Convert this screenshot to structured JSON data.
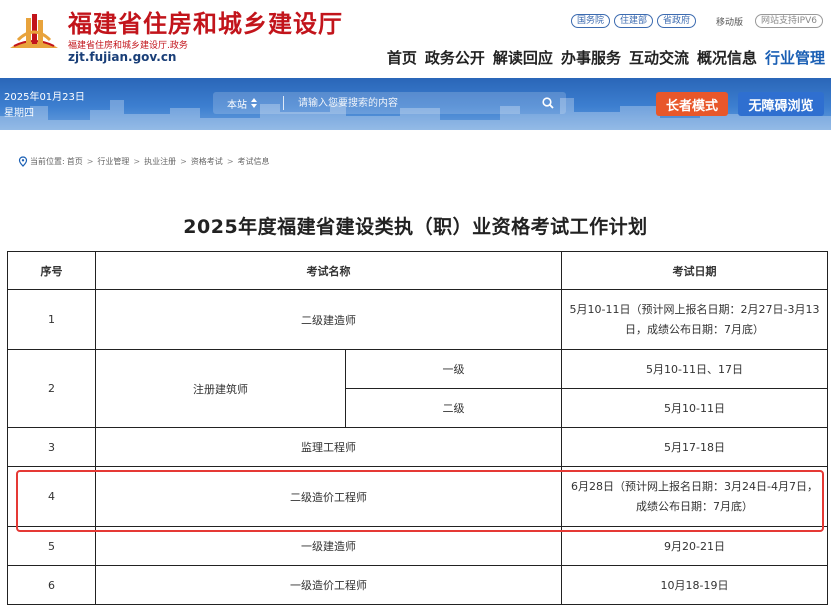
{
  "header": {
    "site_name": "福建省住房和城乡建设厅",
    "site_subtitle": "福建省住房和城乡建设厅.政务",
    "site_domain": "zjt.fujian.gov.cn",
    "top_links": [
      "国务院",
      "住建部",
      "省政府"
    ],
    "mobile_label": "移动版",
    "ipv6_label": "网站支持IPV6",
    "nav": [
      "首页",
      "政务公开",
      "解读回应",
      "办事服务",
      "互动交流",
      "概况信息",
      "行业管理"
    ],
    "active_nav": "行业管理",
    "brand_color": "#c2141b",
    "accent_color": "#1a5fb4"
  },
  "banner": {
    "date": "2025年01月23日",
    "weekday": "星期四",
    "search_scope": "本站",
    "search_placeholder": "请输入您要搜索的内容",
    "elder_mode_label": "长者模式",
    "accessible_label": "无障碍浏览",
    "elder_color": "#e8572a",
    "accessible_color": "#2f6fd0"
  },
  "breadcrumb": {
    "prefix": "当前位置:",
    "items": [
      "首页",
      "行业管理",
      "执业注册",
      "资格考试",
      "考试信息"
    ]
  },
  "page": {
    "title": "2025年度福建省建设类执（职）业资格考试工作计划"
  },
  "table": {
    "headers": [
      "序号",
      "考试名称",
      "考试日期"
    ],
    "rows": [
      {
        "no": "1",
        "name": "二级建造师",
        "date": "5月10-11日（预计网上报名日期：2月27日-3月13日，成绩公布日期：7月底）"
      },
      {
        "no": "2",
        "name": "注册建筑师",
        "level": "一级",
        "date": "5月10-11日、17日"
      },
      {
        "level": "二级",
        "date": "5月10-11日"
      },
      {
        "no": "3",
        "name": "监理工程师",
        "date": "5月17-18日"
      },
      {
        "no": "4",
        "name": "二级造价工程师",
        "date": "6月28日（预计网上报名日期：3月24日-4月7日，成绩公布日期：7月底）"
      },
      {
        "no": "5",
        "name": "一级建造师",
        "date": "9月20-21日"
      },
      {
        "no": "6",
        "name": "一级造价工程师",
        "date": "10月18-19日"
      }
    ],
    "highlight_color": "#e53935"
  }
}
